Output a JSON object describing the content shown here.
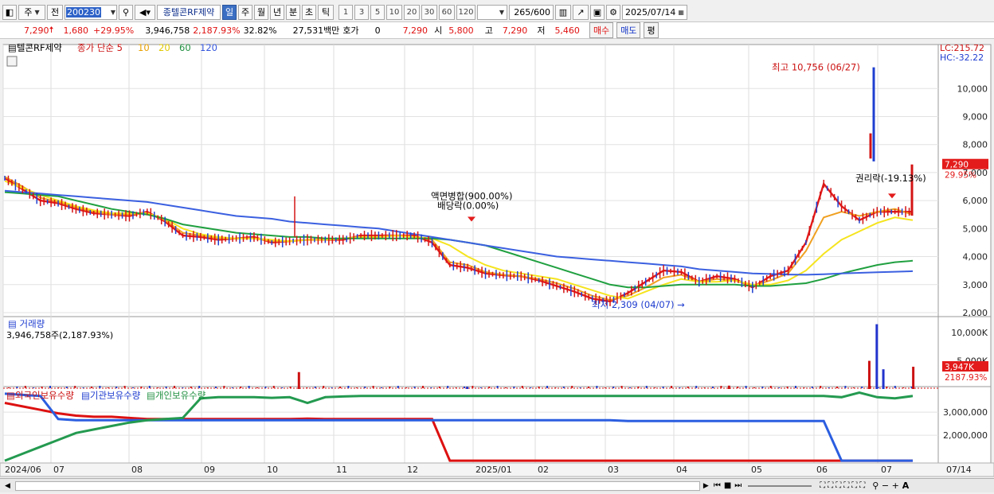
{
  "toolbar": {
    "market": "주",
    "prev": "전",
    "code": "200230",
    "badge": "종",
    "name": "텔콘RF제약",
    "periods": [
      "일",
      "주",
      "월",
      "년",
      "분",
      "초",
      "틱"
    ],
    "intervals": [
      "1",
      "3",
      "5",
      "10",
      "20",
      "30",
      "60",
      "120"
    ],
    "count": "265",
    "count_total": "/600",
    "date": "2025/07/14"
  },
  "quote": {
    "price": "7,290",
    "change": "1,680",
    "change_pct": "+29.95%",
    "volume": "3,946,758",
    "volume_pct": "2,187.93%",
    "turnover": "32.82%",
    "amount": "27,531백만",
    "hoga_label": "호가",
    "hoga_val": "0",
    "hoga_price": "7,290",
    "open_label": "시",
    "open": "5,800",
    "high_label": "고",
    "high": "7,290",
    "low_label": "저",
    "low": "5,460",
    "buy": "매수",
    "sell": "매도",
    "avg": "평"
  },
  "chart_data": [
    {
      "type": "line",
      "title": "텔콘RF제약",
      "legend": [
        "종가 단순 5",
        "10",
        "20",
        "60",
        "120"
      ],
      "right_info": [
        "LC:215.72",
        "HC:-32.22"
      ],
      "ylim": [
        1800,
        11400
      ],
      "yticks": [
        "10,000",
        "9,000",
        "8,000",
        "7,000",
        "6,000",
        "5,000",
        "4,000",
        "3,000",
        "2,000"
      ],
      "x_labels": [
        "2024/06",
        "07",
        "08",
        "09",
        "10",
        "11",
        "12",
        "2025/01",
        "02",
        "03",
        "04",
        "05",
        "06",
        "07",
        "07/14"
      ],
      "price_tag": {
        "value": "7,290",
        "pct": "29.95%"
      },
      "annotations": {
        "high": "최고 10,756 (06/27)",
        "low": "최저 2,309 (04/07)",
        "merge": "액면병합(900.00%)",
        "dividend": "배당락(0.00%)",
        "rights": "권리락(-19.13%)"
      },
      "series": [
        {
          "name": "5",
          "color": "#e41a1a",
          "values": [
            6800,
            6400,
            6000,
            5900,
            5700,
            5550,
            5500,
            5450,
            5600,
            5250,
            4750,
            4700,
            4600,
            4650,
            4700,
            4500,
            4550,
            4600,
            4600,
            4600,
            4750,
            4750,
            4750,
            4750,
            4500,
            3700,
            3600,
            3400,
            3330,
            3300,
            3150,
            2950,
            2750,
            2500,
            2400,
            2700,
            3100,
            3500,
            3450,
            3100,
            3300,
            3200,
            2900,
            3300,
            3500,
            4500,
            6600,
            5800,
            5300,
            5600,
            5600,
            5600
          ]
        },
        {
          "name": "10",
          "color": "#f0a020",
          "values": [
            6850,
            6500,
            6100,
            5950,
            5750,
            5600,
            5500,
            5500,
            5550,
            5300,
            4850,
            4750,
            4650,
            4650,
            4650,
            4550,
            4550,
            4600,
            4600,
            4650,
            4700,
            4700,
            4750,
            4700,
            4600,
            3800,
            3700,
            3450,
            3350,
            3300,
            3200,
            3050,
            2850,
            2600,
            2450,
            2600,
            2900,
            3250,
            3350,
            3100,
            3200,
            3150,
            2950,
            3150,
            3400,
            4200,
            5400,
            5600,
            5450,
            5600,
            5700,
            5500
          ]
        },
        {
          "name": "20",
          "color": "#f5e41e",
          "values": [
            6700,
            6450,
            6200,
            6000,
            5800,
            5650,
            5550,
            5550,
            5550,
            5350,
            5000,
            4800,
            4700,
            4650,
            4650,
            4600,
            4550,
            4600,
            4600,
            4650,
            4700,
            4700,
            4750,
            4700,
            4650,
            4400,
            4000,
            3700,
            3500,
            3400,
            3300,
            3200,
            3000,
            2800,
            2600,
            2500,
            2750,
            3000,
            3200,
            3100,
            3100,
            3150,
            3000,
            3000,
            3150,
            3500,
            4100,
            4600,
            4900,
            5200,
            5400,
            5300
          ]
        },
        {
          "name": "60",
          "color": "#20a040",
          "values": [
            6300,
            6250,
            6200,
            6150,
            6000,
            5850,
            5700,
            5600,
            5500,
            5350,
            5150,
            5050,
            4950,
            4850,
            4800,
            4750,
            4700,
            4700,
            4650,
            4650,
            4650,
            4650,
            4650,
            4650,
            4650,
            4600,
            4500,
            4400,
            4200,
            4000,
            3800,
            3600,
            3400,
            3200,
            3000,
            2900,
            2900,
            2950,
            3000,
            3000,
            3000,
            3000,
            2950,
            2950,
            3000,
            3050,
            3200,
            3400,
            3550,
            3700,
            3800,
            3850
          ]
        },
        {
          "name": "120",
          "color": "#3b60e0",
          "values": [
            6350,
            6300,
            6250,
            6200,
            6150,
            6100,
            6050,
            6000,
            5950,
            5850,
            5750,
            5650,
            5550,
            5450,
            5400,
            5350,
            5250,
            5200,
            5150,
            5100,
            5050,
            5000,
            4900,
            4800,
            4700,
            4600,
            4500,
            4400,
            4300,
            4200,
            4100,
            4000,
            3950,
            3900,
            3850,
            3800,
            3750,
            3700,
            3650,
            3550,
            3500,
            3450,
            3400,
            3380,
            3360,
            3350,
            3370,
            3400,
            3420,
            3440,
            3460,
            3480
          ]
        }
      ]
    },
    {
      "type": "bar",
      "title": "거래량",
      "subtitle": "3,946,758주(2,187.93%)",
      "yticks": [
        "10,000K",
        "5,000K"
      ],
      "tag": {
        "value": "3,947K",
        "pct": "2187.93%"
      },
      "ylim": [
        0,
        12000
      ],
      "spikes": [
        {
          "pos": 0.315,
          "value": 3000,
          "color": "#cc1111"
        },
        {
          "pos": 0.495,
          "value": 400,
          "color": "#2233cc"
        },
        {
          "pos": 0.775,
          "value": 600,
          "color": "#cc1111"
        },
        {
          "pos": 0.925,
          "value": 5000,
          "color": "#cc1111"
        },
        {
          "pos": 0.933,
          "value": 11500,
          "color": "#2233cc"
        },
        {
          "pos": 0.94,
          "value": 3500,
          "color": "#2233cc"
        },
        {
          "pos": 0.972,
          "value": 3950,
          "color": "#cc1111"
        }
      ]
    },
    {
      "type": "line",
      "title": "외국인보유수량",
      "legend": [
        "외국인보유수량",
        "기관보유수량",
        "개인보유수량"
      ],
      "yticks": [
        "3,000,000",
        "2,000,000"
      ],
      "ylim": [
        800000,
        3900000
      ],
      "series": [
        {
          "name": "외국인보유수량",
          "color": "#dd1111",
          "values": [
            3400000,
            3250000,
            3100000,
            2950000,
            2850000,
            2800000,
            2800000,
            2750000,
            2700000,
            2700000,
            2700000,
            2700000,
            2700000,
            2700000,
            2700000,
            2700000,
            2700000,
            2720000,
            2700000,
            2700000,
            2700000,
            2700000,
            2700000,
            2700000,
            2700000,
            900000,
            900000,
            900000,
            900000,
            900000,
            900000,
            900000,
            900000,
            900000,
            900000,
            900000,
            900000,
            900000,
            900000,
            900000,
            900000,
            900000,
            900000,
            900000,
            900000,
            900000,
            900000,
            900000,
            900000,
            900000,
            900000,
            900000
          ]
        },
        {
          "name": "기관보유수량",
          "color": "#2b5ee0",
          "values": [
            3800000,
            3750000,
            3700000,
            2700000,
            2650000,
            2650000,
            2650000,
            2650000,
            2650000,
            2650000,
            2650000,
            2650000,
            2650000,
            2650000,
            2650000,
            2650000,
            2650000,
            2650000,
            2650000,
            2650000,
            2650000,
            2650000,
            2650000,
            2650000,
            2650000,
            2650000,
            2650000,
            2650000,
            2650000,
            2650000,
            2650000,
            2650000,
            2650000,
            2650000,
            2650000,
            2620000,
            2620000,
            2620000,
            2620000,
            2620000,
            2620000,
            2620000,
            2620000,
            2620000,
            2620000,
            2620000,
            2620000,
            900000,
            900000,
            900000,
            900000,
            900000
          ]
        },
        {
          "name": "개인보유수량",
          "color": "#249a50",
          "values": [
            900000,
            1200000,
            1500000,
            1800000,
            2100000,
            2250000,
            2400000,
            2550000,
            2650000,
            2700000,
            2750000,
            3600000,
            3650000,
            3650000,
            3650000,
            3620000,
            3650000,
            3400000,
            3650000,
            3680000,
            3700000,
            3700000,
            3700000,
            3700000,
            3700000,
            3700000,
            3700000,
            3700000,
            3700000,
            3700000,
            3700000,
            3700000,
            3700000,
            3700000,
            3700000,
            3700000,
            3700000,
            3700000,
            3700000,
            3700000,
            3700000,
            3700000,
            3700000,
            3700000,
            3700000,
            3700000,
            3700000,
            3650000,
            3850000,
            3650000,
            3600000,
            3700000
          ]
        }
      ]
    }
  ]
}
